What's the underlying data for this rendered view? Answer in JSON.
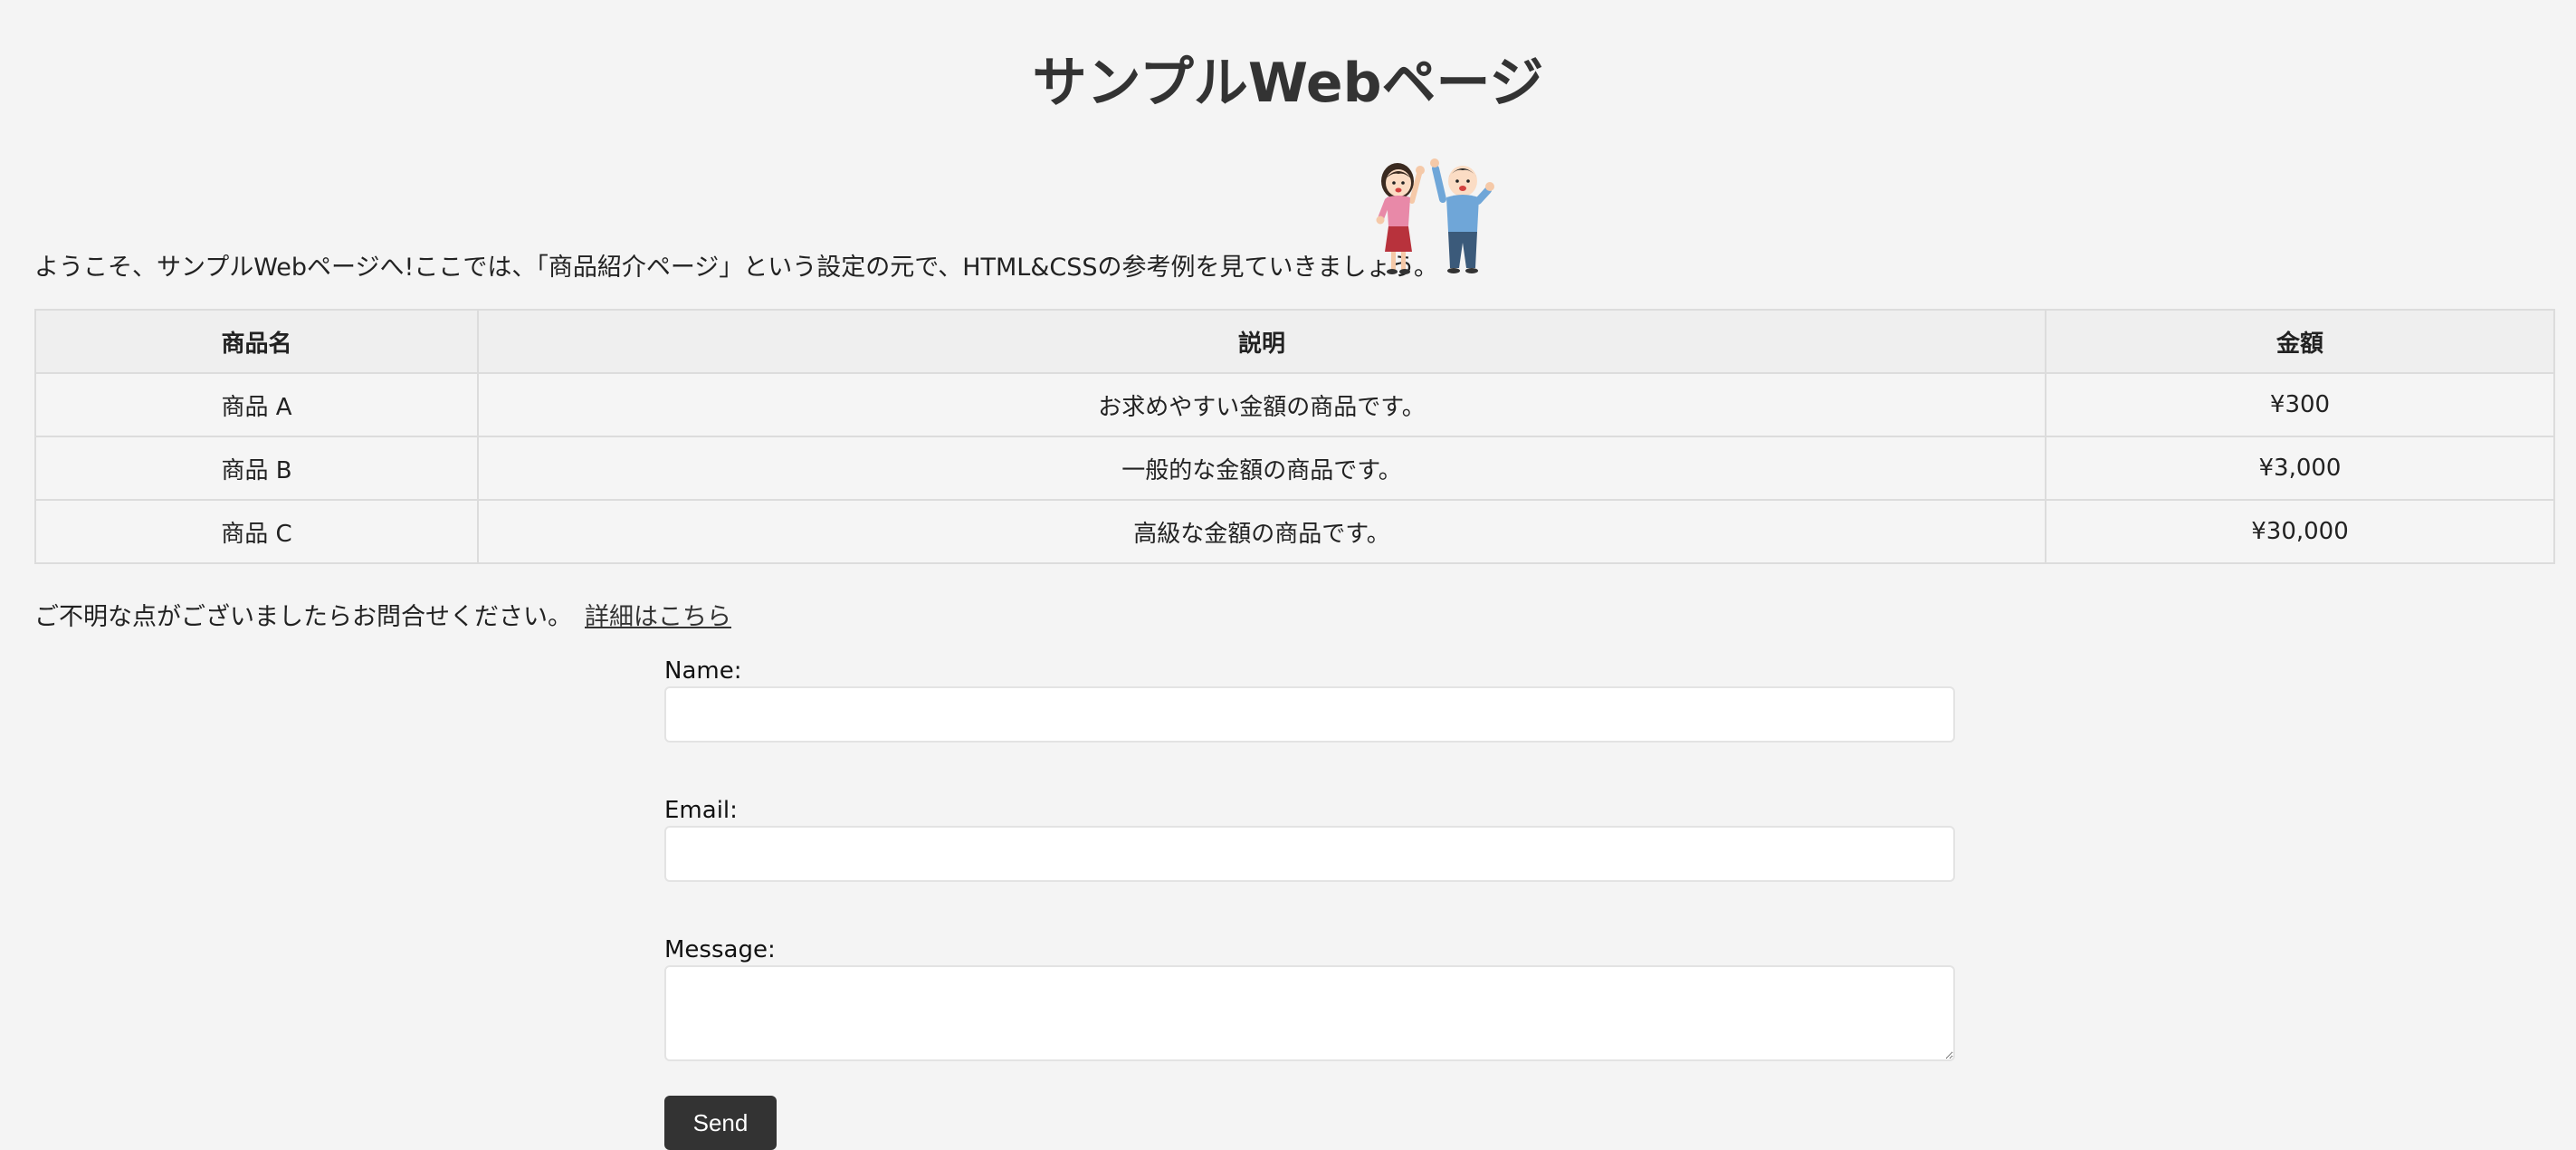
{
  "header": {
    "title": "サンプルWebページ"
  },
  "intro": {
    "text": "ようこそ、サンプルWebページへ!ここでは、「商品紹介ページ」という設定の元で、HTML&CSSの参考例を見ていきましょう。",
    "illustration": "cheering-couple-illustration"
  },
  "products": {
    "headers": {
      "name": "商品名",
      "description": "説明",
      "price": "金額"
    },
    "rows": [
      {
        "name": "商品 A",
        "description": "お求めやすい金額の商品です。",
        "price": "¥300"
      },
      {
        "name": "商品 B",
        "description": "一般的な金額の商品です。",
        "price": "¥3,000"
      },
      {
        "name": "商品 C",
        "description": "高級な金額の商品です。",
        "price": "¥30,000"
      }
    ]
  },
  "notice": {
    "text": "ご不明な点がございましたらお問合せください。",
    "link_label": "詳細はこちら"
  },
  "contact_form": {
    "name_label": "Name:",
    "name_value": "",
    "email_label": "Email:",
    "email_value": "",
    "message_label": "Message:",
    "message_value": "",
    "send_label": "Send"
  },
  "colors": {
    "background": "#f4f4f4",
    "heading": "#333333",
    "table_header_bg": "#efefef",
    "table_border": "#dcdcdc",
    "button_bg": "#333333",
    "button_text": "#ffffff"
  }
}
